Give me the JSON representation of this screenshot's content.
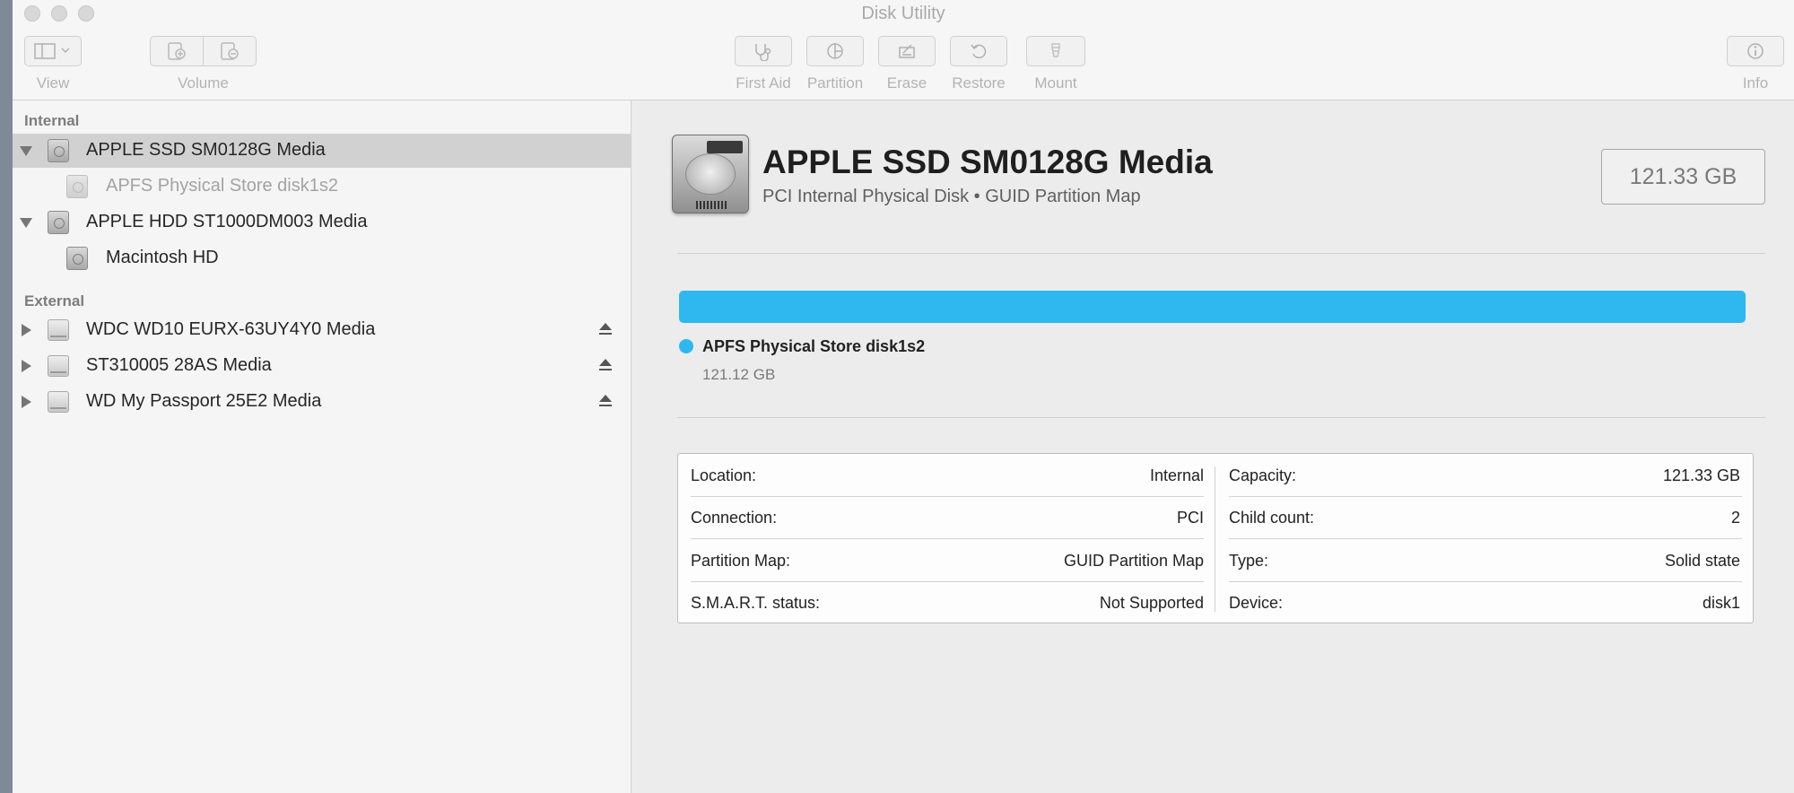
{
  "window": {
    "title": "Disk Utility"
  },
  "toolbar": {
    "view_label": "View",
    "volume_label": "Volume",
    "first_aid_label": "First Aid",
    "partition_label": "Partition",
    "erase_label": "Erase",
    "restore_label": "Restore",
    "mount_label": "Mount",
    "info_label": "Info"
  },
  "sidebar": {
    "internal_header": "Internal",
    "external_header": "External",
    "internal": [
      {
        "label": "APPLE SSD SM0128G Media",
        "expanded": true,
        "selected": true
      },
      {
        "label": "APFS Physical Store disk1s2",
        "dimmed": true
      },
      {
        "label": "APPLE HDD ST1000DM003 Media",
        "expanded": true
      },
      {
        "label": "Macintosh HD"
      }
    ],
    "external": [
      {
        "label": "WDC WD10 EURX-63UY4Y0 Media",
        "eject": "eject-icon"
      },
      {
        "label": "ST310005 28AS Media",
        "eject": "eject-icon"
      },
      {
        "label": "WD My Passport 25E2 Media",
        "eject": "eject-icon"
      }
    ]
  },
  "detail": {
    "disk_name": "APPLE SSD SM0128G Media",
    "subtitle": "PCI Internal Physical Disk • GUID Partition Map",
    "capacity_badge": "121.33 GB",
    "usage_color": "#2eb8ef",
    "partition": {
      "name": "APFS Physical Store disk1s2",
      "size": "121.12 GB"
    },
    "info": {
      "left": [
        {
          "key": "Location:",
          "value": "Internal"
        },
        {
          "key": "Connection:",
          "value": "PCI"
        },
        {
          "key": "Partition Map:",
          "value": "GUID Partition Map"
        },
        {
          "key": "S.M.A.R.T. status:",
          "value": "Not Supported"
        }
      ],
      "right": [
        {
          "key": "Capacity:",
          "value": "121.33 GB"
        },
        {
          "key": "Child count:",
          "value": "2"
        },
        {
          "key": "Type:",
          "value": "Solid state"
        },
        {
          "key": "Device:",
          "value": "disk1"
        }
      ]
    }
  }
}
